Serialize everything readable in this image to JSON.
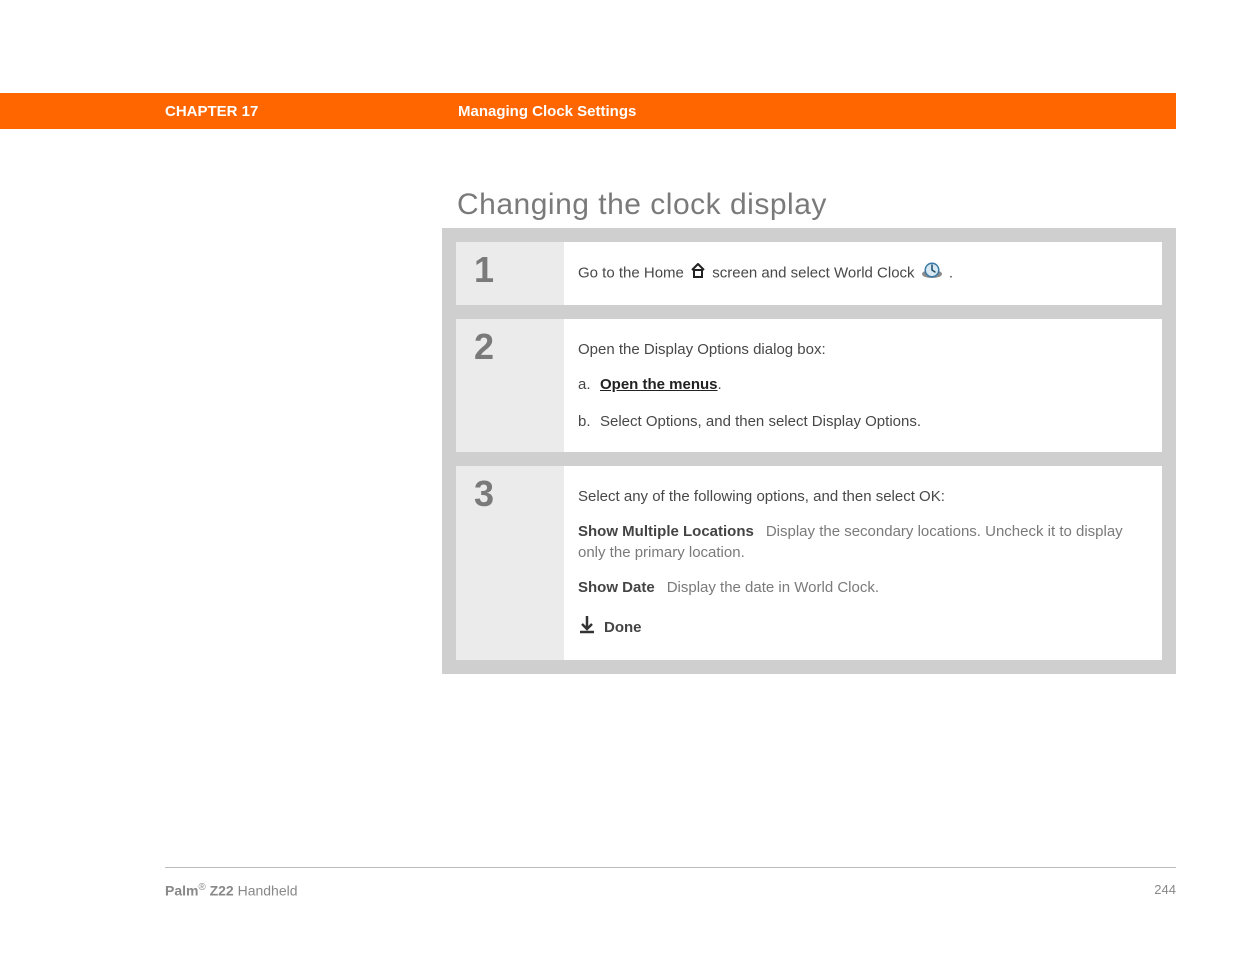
{
  "header": {
    "chapter": "CHAPTER 17",
    "title": "Managing Clock Settings"
  },
  "heading": "Changing the clock display",
  "steps": [
    {
      "num": "1",
      "line1_pre": "Go to the Home ",
      "line1_mid": " screen and select World Clock ",
      "line1_post": "."
    },
    {
      "num": "2",
      "intro": "Open the Display Options dialog box:",
      "subs": [
        {
          "letter": "a.",
          "link": "Open the menus",
          "after": "."
        },
        {
          "letter": "b.",
          "text": "Select Options, and then select Display Options."
        }
      ]
    },
    {
      "num": "3",
      "intro": "Select any of the following options, and then select OK:",
      "options": [
        {
          "label": "Show Multiple Locations",
          "desc": "Display the secondary locations. Uncheck it to display only the primary location."
        },
        {
          "label": "Show Date",
          "desc": "Display the date in World Clock."
        }
      ],
      "done": "Done"
    }
  ],
  "footer": {
    "brand_bold": "Palm",
    "brand_reg": "®",
    "brand_model": " Z22",
    "brand_tail": " Handheld",
    "page": "244"
  }
}
